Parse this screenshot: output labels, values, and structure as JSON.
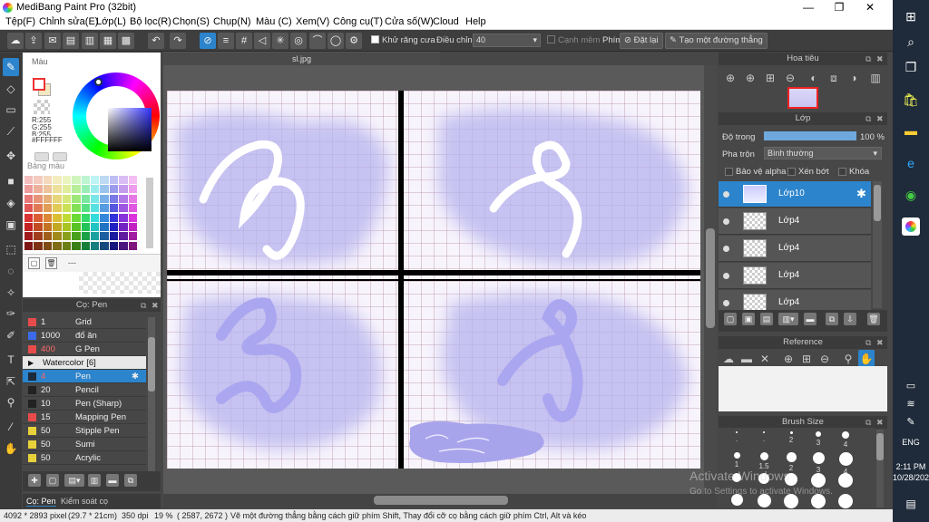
{
  "window": {
    "title": "MediBang Paint Pro (32bit)",
    "minimize": "—",
    "maximize": "❐",
    "close": "✕"
  },
  "menu": [
    "Tệp(F)",
    "Chỉnh sửa(E)",
    "Lớp(L)",
    "Bộ lọc(R)",
    "Chọn(S)",
    "Chụp(N)",
    "Màu (C)",
    "Xem(V)",
    "Công cụ(T)",
    "Cửa số(W)",
    "Cloud",
    "Help"
  ],
  "toolbar": {
    "antialias": "Khử răng cưa",
    "correction_label": "Điều chỉnh",
    "correction_value": "40",
    "edge_label": "Cạnh mềm",
    "keys_label": "Phím",
    "reset_button": "Đặt lại",
    "straight_line_button": "Tạo một đường thẳng"
  },
  "color_panel": {
    "title": "Màu",
    "r": "R:255",
    "g": "G:255",
    "b": "B:255",
    "hex": "#FFFFFF",
    "palette_title": "Bảng màu",
    "more": "---"
  },
  "brush_panel": {
    "title": "Cọ: Pen",
    "items": [
      {
        "size": "1",
        "name": "Grid",
        "color": "#e84b4b"
      },
      {
        "size": "1000",
        "name": "đổ ăn",
        "color": "#3a6be8"
      },
      {
        "size": "400",
        "name": "G Pen",
        "color": "#e84b4b"
      },
      {
        "size": "",
        "name": "Watercolor [6]",
        "color": ""
      },
      {
        "size": "4",
        "name": "Pen",
        "color": "#1d2a3a"
      },
      {
        "size": "20",
        "name": "Pencil",
        "color": "#222222"
      },
      {
        "size": "10",
        "name": "Pen (Sharp)",
        "color": "#222222"
      },
      {
        "size": "15",
        "name": "Mapping Pen",
        "color": "#e84b4b"
      },
      {
        "size": "50",
        "name": "Stipple Pen",
        "color": "#e8d23a"
      },
      {
        "size": "50",
        "name": "Sumi",
        "color": "#e8d23a"
      },
      {
        "size": "50",
        "name": "Acrylic",
        "color": "#e8d23a"
      }
    ]
  },
  "bottom_tabs": {
    "brush": "Cọ: Pen",
    "inspector": "Kiểm soát cọ"
  },
  "document": {
    "tab": "sl.jpg"
  },
  "navigator": {
    "title": "Hoa tiêu"
  },
  "layers": {
    "title": "Lớp",
    "opacity_label": "Độ trong",
    "opacity_value": "100 %",
    "opacity": 1.0,
    "blend_label": "Pha trộn",
    "blend_value": "Bình thường",
    "alpha_protect": "Bảo vệ alpha",
    "clipping": "Xén bớt",
    "lock": "Khóa",
    "items": [
      "Lớp10",
      "Lớp4",
      "Lớp4",
      "Lớp4",
      "Lớp4"
    ]
  },
  "reference": {
    "title": "Reference"
  },
  "brush_size": {
    "title": "Brush Size",
    "labels": [
      ".",
      ".",
      "2",
      "3",
      "4",
      "1",
      "1.5",
      "2",
      "3",
      "4"
    ]
  },
  "status": {
    "size": "4092 * 2893 pixel",
    "cm": "(29.7 * 21cm)",
    "dpi": "350 dpi",
    "zoom": "19 %",
    "coords": "( 2587, 2672 )",
    "hint": "Vẽ một đường thẳng bằng cách giữ phím Shift, Thay đổi cỡ cọ bằng cách giữ phím Ctrl, Alt và kéo"
  },
  "watermark": {
    "line1": "Activate Windows",
    "line2": "Go to Settings to activate Windows."
  },
  "taskbar": {
    "time": "2:11 PM",
    "date": "10/28/2021",
    "lang": "ENG"
  },
  "colors": {
    "accent": "#2c84cc",
    "panel": "#474747",
    "canvas": "#f8f4fc",
    "lavender": "#aaa6f0"
  }
}
